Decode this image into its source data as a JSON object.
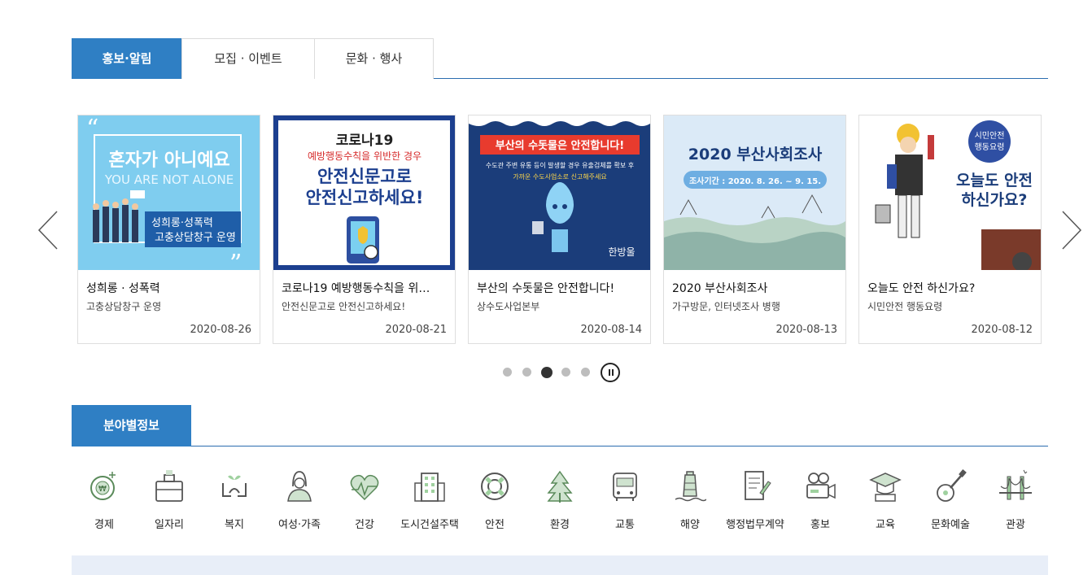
{
  "tabs": [
    {
      "label": "홍보·알림",
      "active": true
    },
    {
      "label": "모집 · 이벤트",
      "active": false
    },
    {
      "label": "문화 · 행사",
      "active": false
    }
  ],
  "cards": [
    {
      "title": "성희롱 · 성폭력",
      "subtitle": "고충상담창구 운영",
      "date": "2020-08-26",
      "thumb_text": {
        "line1": "혼자가 아니예요",
        "line2": "YOU ARE NOT ALONE",
        "line3": "성희롱·성폭력",
        "line4": "고충상담창구 운영"
      }
    },
    {
      "title": "코로나19 예방행동수칙을 위…",
      "subtitle": "안전신문고로 안전신고하세요!",
      "date": "2020-08-21",
      "thumb_text": {
        "line1": "코로나19",
        "line2": "예방행동수칙을 위반한 경우",
        "line3": "안전신문고로",
        "line4": "안전신고하세요!"
      }
    },
    {
      "title": "부산의 수돗물은 안전합니다!",
      "subtitle": "상수도사업본부",
      "date": "2020-08-14",
      "thumb_text": {
        "line1": "부산의 수돗물은 안전합니다!",
        "line2": "수도관 주변 유통 등이 발생할 경우 유출검체를 확보 후",
        "line3": "가까운 수도사업소로 신고해주세요",
        "line4": "한방울"
      }
    },
    {
      "title": "2020 부산사회조사",
      "subtitle": "가구방문, 인터넷조사 병행",
      "date": "2020-08-13",
      "thumb_text": {
        "line1": "2020 부산사회조사",
        "line2": "조사기간 : 2020. 8. 26. ~ 9. 15."
      }
    },
    {
      "title": "오늘도 안전 하신가요?",
      "subtitle": "시민안전 행동요령",
      "date": "2020-08-12",
      "thumb_text": {
        "line1": "시민안전",
        "line2": "행동요령",
        "line3": "오늘도 안전",
        "line4": "하신가요?"
      }
    }
  ],
  "carousel": {
    "active_index": 2,
    "count": 5
  },
  "section2": {
    "title": "분야별정보"
  },
  "fields": [
    {
      "label": "경제",
      "icon": "economy-icon"
    },
    {
      "label": "일자리",
      "icon": "briefcase-icon"
    },
    {
      "label": "복지",
      "icon": "welfare-icon"
    },
    {
      "label": "여성·가족",
      "icon": "woman-icon"
    },
    {
      "label": "건강",
      "icon": "heart-icon"
    },
    {
      "label": "도시건설주택",
      "icon": "building-icon"
    },
    {
      "label": "안전",
      "icon": "lifebuoy-icon"
    },
    {
      "label": "환경",
      "icon": "tree-icon"
    },
    {
      "label": "교통",
      "icon": "bus-icon"
    },
    {
      "label": "해양",
      "icon": "lighthouse-icon"
    },
    {
      "label": "행정법무계약",
      "icon": "document-icon"
    },
    {
      "label": "홍보",
      "icon": "camera-icon"
    },
    {
      "label": "교육",
      "icon": "graduation-icon"
    },
    {
      "label": "문화예술",
      "icon": "guitar-icon"
    },
    {
      "label": "관광",
      "icon": "bridge-icon"
    }
  ],
  "colors": {
    "primary": "#2f7fc4",
    "icon": "#5a8a5a"
  }
}
